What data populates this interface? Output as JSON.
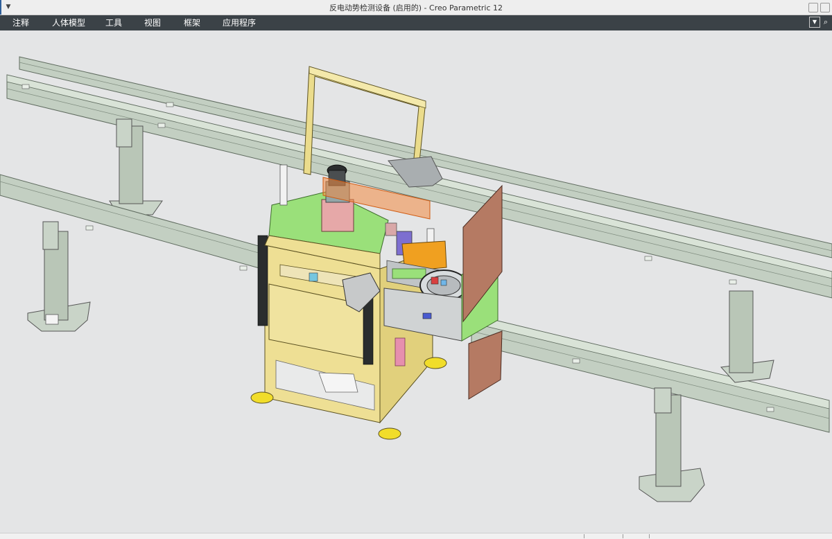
{
  "window": {
    "title": "反电动势检测设备 (启用的) - Creo Parametric 12"
  },
  "menu": {
    "items": [
      {
        "label": "注释"
      },
      {
        "label": "人体模型"
      },
      {
        "label": "工具"
      },
      {
        "label": "视图"
      },
      {
        "label": "框架"
      },
      {
        "label": "应用程序"
      }
    ]
  },
  "icons": {
    "quick_access": "dropdown-arrow-icon",
    "ribbon_toggle": "chevron-down-icon",
    "search": "search-icon"
  },
  "colors": {
    "menubar": "#3b4247",
    "viewport": "#e4e5e6",
    "frame_yellow": "#ebdc8c",
    "rail_gray": "#b9c7b8",
    "plate_green": "#9ae07a",
    "brown_panel": "#b57a63",
    "orange_part": "#f0a020",
    "purple_part": "#7d6fd0"
  }
}
